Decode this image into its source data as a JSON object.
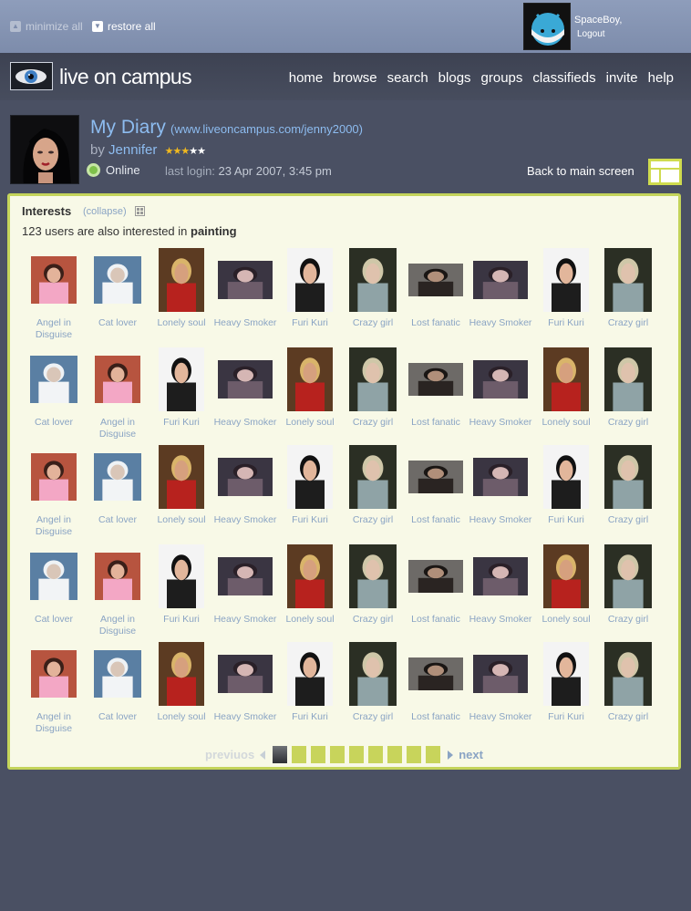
{
  "topbar": {
    "minimize_label": "minimize all",
    "restore_label": "restore all",
    "user_name": "SpaceBoy,",
    "logout_label": "Logout"
  },
  "header": {
    "brand": "live on campus",
    "nav": [
      "home",
      "browse",
      "search",
      "blogs",
      "groups",
      "classifieds",
      "invite",
      "help"
    ]
  },
  "profile": {
    "title": "My Diary",
    "url": "(www.liveoncampus.com/jenny2000)",
    "by_label": "by",
    "author": "Jennifer",
    "rating": 3,
    "rating_max": 5,
    "status": "Online",
    "last_login_label": "last login:",
    "last_login": "23 Apr 2007, 3:45 pm",
    "back_label": "Back to main screen"
  },
  "panel": {
    "title": "Interests",
    "collapse_label": "(collapse)",
    "subtitle_prefix": "123 users are also interested in",
    "subtitle_interest": "painting",
    "users": [
      [
        "Angel in Disguise",
        "Cat lover",
        "Lonely soul",
        "Heavy Smoker",
        "Furi Kuri",
        "Crazy girl",
        "Lost fanatic",
        "Heavy Smoker",
        "Furi Kuri",
        "Crazy girl"
      ],
      [
        "Cat lover",
        "Angel in Disguise",
        "Furi Kuri",
        "Heavy Smoker",
        "Lonely soul",
        "Crazy girl",
        "Lost fanatic",
        "Heavy Smoker",
        "Lonely soul",
        "Crazy girl"
      ],
      [
        "Angel in Disguise",
        "Cat lover",
        "Lonely soul",
        "Heavy Smoker",
        "Furi Kuri",
        "Crazy girl",
        "Lost fanatic",
        "Heavy Smoker",
        "Furi Kuri",
        "Crazy girl"
      ],
      [
        "Cat lover",
        "Angel in Disguise",
        "Furi Kuri",
        "Heavy Smoker",
        "Lonely soul",
        "Crazy girl",
        "Lost fanatic",
        "Heavy Smoker",
        "Lonely soul",
        "Crazy girl"
      ],
      [
        "Angel in Disguise",
        "Cat lover",
        "Lonely soul",
        "Heavy Smoker",
        "Furi Kuri",
        "Crazy girl",
        "Lost fanatic",
        "Heavy Smoker",
        "Furi Kuri",
        "Crazy girl"
      ]
    ],
    "pager": {
      "prev_label": "previuos",
      "next_label": "next",
      "pages": 9,
      "current": 1
    }
  },
  "colors": {
    "accent_green": "#c8d45b",
    "link_blue": "#8dbcf0",
    "caption_blue": "#8aa4c4",
    "panel_bg": "#f8f9e7",
    "page_bg": "#4a5063",
    "star": "#f0b81f"
  }
}
